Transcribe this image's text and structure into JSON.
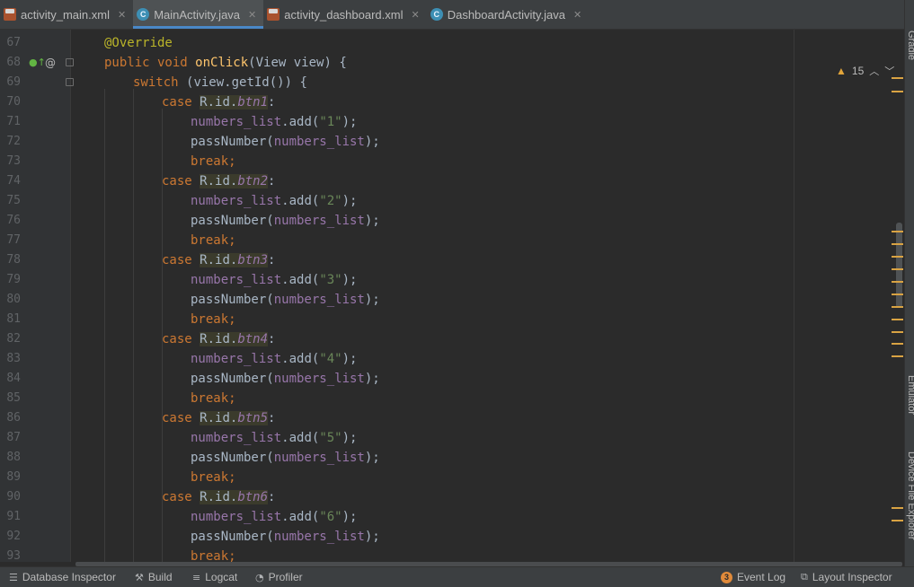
{
  "tabs": [
    {
      "label": "activity_main.xml",
      "type": "xml",
      "active": false
    },
    {
      "label": "MainActivity.java",
      "type": "java",
      "active": true
    },
    {
      "label": "activity_dashboard.xml",
      "type": "xml",
      "active": false
    },
    {
      "label": "DashboardActivity.java",
      "type": "java",
      "active": false
    }
  ],
  "warnings": {
    "count": "15"
  },
  "lines": [
    {
      "n": "67",
      "indent": 1,
      "tokens": [
        [
          "ann",
          "@Override"
        ]
      ]
    },
    {
      "n": "68",
      "indent": 1,
      "tokens": [
        [
          "kw",
          "public void "
        ],
        [
          "fn",
          "onClick"
        ],
        [
          "",
          "(View view) {"
        ]
      ]
    },
    {
      "n": "69",
      "indent": 2,
      "tokens": [
        [
          "kw",
          "switch "
        ],
        [
          "",
          "(view.getId()) {"
        ]
      ]
    },
    {
      "n": "70",
      "indent": 3,
      "tokens": [
        [
          "kw",
          "case "
        ],
        [
          "ref",
          "R.id."
        ],
        [
          "refi",
          "btn1"
        ],
        [
          "",
          ":"
        ]
      ]
    },
    {
      "n": "71",
      "indent": 4,
      "tokens": [
        [
          "field",
          "numbers_list"
        ],
        [
          "",
          ".add("
        ],
        [
          "str",
          "\"1\""
        ],
        [
          "",
          ");"
        ]
      ]
    },
    {
      "n": "72",
      "indent": 4,
      "tokens": [
        [
          "",
          "passNumber("
        ],
        [
          "field",
          "numbers_list"
        ],
        [
          "",
          ");"
        ]
      ]
    },
    {
      "n": "73",
      "indent": 4,
      "tokens": [
        [
          "kw",
          "break;"
        ]
      ]
    },
    {
      "n": "74",
      "indent": 3,
      "tokens": [
        [
          "kw",
          "case "
        ],
        [
          "ref",
          "R.id."
        ],
        [
          "refi",
          "btn2"
        ],
        [
          "",
          ":"
        ]
      ]
    },
    {
      "n": "75",
      "indent": 4,
      "tokens": [
        [
          "field",
          "numbers_list"
        ],
        [
          "",
          ".add("
        ],
        [
          "str",
          "\"2\""
        ],
        [
          "",
          ");"
        ]
      ]
    },
    {
      "n": "76",
      "indent": 4,
      "tokens": [
        [
          "",
          "passNumber("
        ],
        [
          "field",
          "numbers_list"
        ],
        [
          "",
          ");"
        ]
      ]
    },
    {
      "n": "77",
      "indent": 4,
      "tokens": [
        [
          "kw",
          "break;"
        ]
      ]
    },
    {
      "n": "78",
      "indent": 3,
      "tokens": [
        [
          "kw",
          "case "
        ],
        [
          "ref",
          "R.id."
        ],
        [
          "refi",
          "btn3"
        ],
        [
          "",
          ":"
        ]
      ]
    },
    {
      "n": "79",
      "indent": 4,
      "tokens": [
        [
          "field",
          "numbers_list"
        ],
        [
          "",
          ".add("
        ],
        [
          "str",
          "\"3\""
        ],
        [
          "",
          ");"
        ]
      ]
    },
    {
      "n": "80",
      "indent": 4,
      "tokens": [
        [
          "",
          "passNumber("
        ],
        [
          "field",
          "numbers_list"
        ],
        [
          "",
          ");"
        ]
      ]
    },
    {
      "n": "81",
      "indent": 4,
      "tokens": [
        [
          "kw",
          "break;"
        ]
      ]
    },
    {
      "n": "82",
      "indent": 3,
      "tokens": [
        [
          "kw",
          "case "
        ],
        [
          "ref",
          "R.id."
        ],
        [
          "refi",
          "btn4"
        ],
        [
          "",
          ":"
        ]
      ]
    },
    {
      "n": "83",
      "indent": 4,
      "tokens": [
        [
          "field",
          "numbers_list"
        ],
        [
          "",
          ".add("
        ],
        [
          "str",
          "\"4\""
        ],
        [
          "",
          ");"
        ]
      ]
    },
    {
      "n": "84",
      "indent": 4,
      "tokens": [
        [
          "",
          "passNumber("
        ],
        [
          "field",
          "numbers_list"
        ],
        [
          "",
          ");"
        ]
      ]
    },
    {
      "n": "85",
      "indent": 4,
      "tokens": [
        [
          "kw",
          "break;"
        ]
      ]
    },
    {
      "n": "86",
      "indent": 3,
      "tokens": [
        [
          "kw",
          "case "
        ],
        [
          "ref",
          "R.id."
        ],
        [
          "refi",
          "btn5"
        ],
        [
          "",
          ":"
        ]
      ]
    },
    {
      "n": "87",
      "indent": 4,
      "tokens": [
        [
          "field",
          "numbers_list"
        ],
        [
          "",
          ".add("
        ],
        [
          "str",
          "\"5\""
        ],
        [
          "",
          ");"
        ]
      ]
    },
    {
      "n": "88",
      "indent": 4,
      "tokens": [
        [
          "",
          "passNumber("
        ],
        [
          "field",
          "numbers_list"
        ],
        [
          "",
          ");"
        ]
      ]
    },
    {
      "n": "89",
      "indent": 4,
      "tokens": [
        [
          "kw",
          "break;"
        ]
      ]
    },
    {
      "n": "90",
      "indent": 3,
      "tokens": [
        [
          "kw",
          "case "
        ],
        [
          "ref",
          "R.id."
        ],
        [
          "refi",
          "btn6"
        ],
        [
          "",
          ":"
        ]
      ]
    },
    {
      "n": "91",
      "indent": 4,
      "tokens": [
        [
          "field",
          "numbers_list"
        ],
        [
          "",
          ".add("
        ],
        [
          "str",
          "\"6\""
        ],
        [
          "",
          ");"
        ]
      ]
    },
    {
      "n": "92",
      "indent": 4,
      "tokens": [
        [
          "",
          "passNumber("
        ],
        [
          "field",
          "numbers_list"
        ],
        [
          "",
          ");"
        ]
      ]
    },
    {
      "n": "93",
      "indent": 4,
      "tokens": [
        [
          "kw",
          "break;"
        ]
      ]
    }
  ],
  "side_tools": [
    {
      "label": "Gradle"
    },
    {
      "label": "Emulator"
    },
    {
      "label": "Device File Explorer"
    }
  ],
  "bottom_tools": [
    {
      "label": "Database Inspector",
      "icon": "database-icon"
    },
    {
      "label": "Build",
      "icon": "hammer-icon"
    },
    {
      "label": "Logcat",
      "icon": "logcat-icon"
    },
    {
      "label": "Profiler",
      "icon": "gauge-icon"
    },
    {
      "label": "Event Log",
      "icon": "event-log-icon",
      "badge": "3"
    },
    {
      "label": "Layout Inspector",
      "icon": "layout-inspector-icon"
    }
  ],
  "colors": {
    "editor_bg": "#2b2b2b",
    "keyword": "#cc7832",
    "annotation": "#bbb529",
    "method": "#ffc66d",
    "field": "#9876aa",
    "string": "#6a8759",
    "warning": "#e2a53a",
    "active_tab_accent": "#4a88c7"
  }
}
